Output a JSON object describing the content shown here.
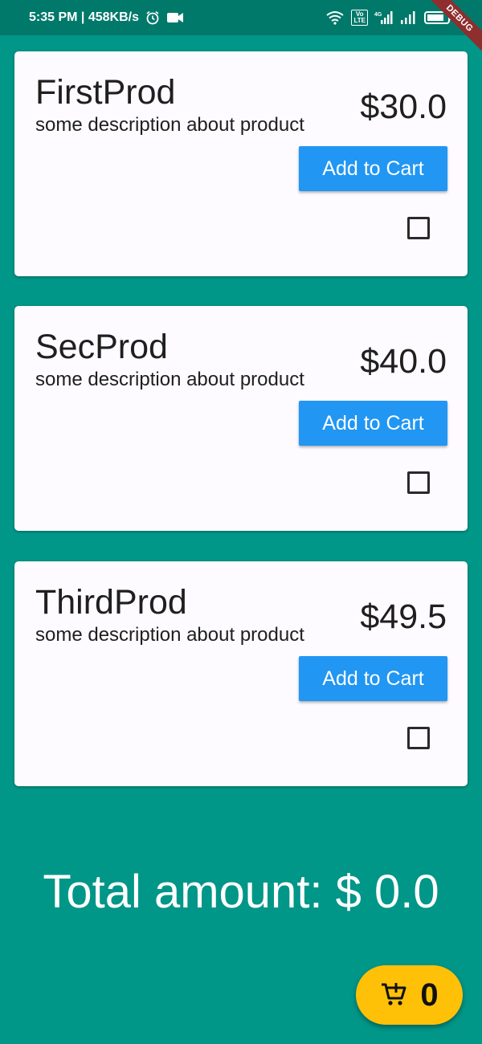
{
  "status_bar": {
    "time_speed": "5:35 PM | 458KB/s",
    "volte_label": "Vo\nLTE",
    "network_label": "4G",
    "icons": [
      "alarm-icon",
      "video-camera-icon",
      "wifi-icon",
      "signal-icon",
      "battery-icon"
    ]
  },
  "debug_banner": "DEBUG",
  "products": [
    {
      "name": "FirstProd",
      "description": "some description about product",
      "price": "$30.0",
      "button_label": "Add to Cart",
      "checked": false
    },
    {
      "name": "SecProd",
      "description": "some description about product",
      "price": "$40.0",
      "button_label": "Add to Cart",
      "checked": false
    },
    {
      "name": "ThirdProd",
      "description": "some description about product",
      "price": "$49.5",
      "button_label": "Add to Cart",
      "checked": false
    }
  ],
  "total": {
    "label": "Total amount: $ 0.0"
  },
  "cart": {
    "count": "0",
    "icon": "cart-add-icon"
  },
  "colors": {
    "background": "#009688",
    "status_bar": "#00796B",
    "button": "#2196F3",
    "fab": "#FFC107",
    "card": "#fdfbff"
  }
}
